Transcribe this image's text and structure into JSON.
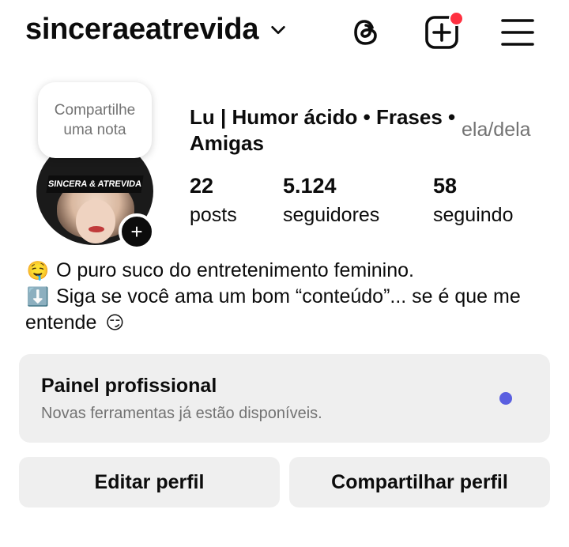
{
  "header": {
    "username": "sinceraeatrevida",
    "icons": {
      "dropdown": "chevron-down-icon",
      "threads": "threads-icon",
      "create": "plus-square-icon",
      "menu": "hamburger-menu-icon"
    },
    "notification_color": "#ff3040"
  },
  "profile": {
    "note_placeholder": "Compartilhe uma nota",
    "avatar_banner": "SINCERA & ATREVIDA",
    "full_name": "Lu | Humor ácido • Frases • Amigas",
    "pronouns": "ela/dela",
    "stats": [
      {
        "number": "22",
        "label": "posts"
      },
      {
        "number": "5.124",
        "label": "seguidores"
      },
      {
        "number": "58",
        "label": "seguindo"
      }
    ],
    "bio": {
      "line1_emoji": "🤤",
      "line1": "O puro suco do entretenimento feminino.",
      "line2_emoji": "⬇️",
      "line2": "Siga se você ama um bom “conteúdo”... se é que me entende",
      "line2_end_emoji": "😏"
    }
  },
  "professional_panel": {
    "title": "Painel profissional",
    "subtitle": "Novas ferramentas já estão disponíveis.",
    "dot_color": "#5a5fe0"
  },
  "buttons": {
    "edit": "Editar perfil",
    "share": "Compartilhar perfil"
  }
}
